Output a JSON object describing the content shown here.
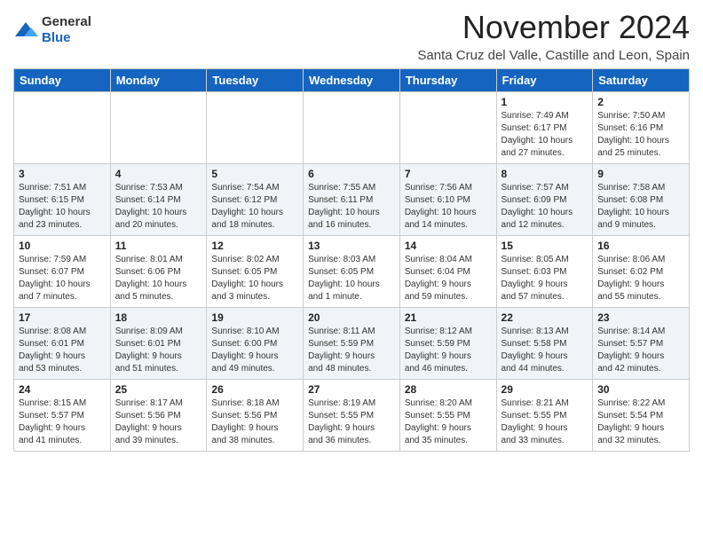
{
  "logo": {
    "general": "General",
    "blue": "Blue"
  },
  "header": {
    "month_year": "November 2024",
    "location": "Santa Cruz del Valle, Castille and Leon, Spain"
  },
  "weekdays": [
    "Sunday",
    "Monday",
    "Tuesday",
    "Wednesday",
    "Thursday",
    "Friday",
    "Saturday"
  ],
  "weeks": [
    [
      {
        "day": "",
        "info": ""
      },
      {
        "day": "",
        "info": ""
      },
      {
        "day": "",
        "info": ""
      },
      {
        "day": "",
        "info": ""
      },
      {
        "day": "",
        "info": ""
      },
      {
        "day": "1",
        "info": "Sunrise: 7:49 AM\nSunset: 6:17 PM\nDaylight: 10 hours\nand 27 minutes."
      },
      {
        "day": "2",
        "info": "Sunrise: 7:50 AM\nSunset: 6:16 PM\nDaylight: 10 hours\nand 25 minutes."
      }
    ],
    [
      {
        "day": "3",
        "info": "Sunrise: 7:51 AM\nSunset: 6:15 PM\nDaylight: 10 hours\nand 23 minutes."
      },
      {
        "day": "4",
        "info": "Sunrise: 7:53 AM\nSunset: 6:14 PM\nDaylight: 10 hours\nand 20 minutes."
      },
      {
        "day": "5",
        "info": "Sunrise: 7:54 AM\nSunset: 6:12 PM\nDaylight: 10 hours\nand 18 minutes."
      },
      {
        "day": "6",
        "info": "Sunrise: 7:55 AM\nSunset: 6:11 PM\nDaylight: 10 hours\nand 16 minutes."
      },
      {
        "day": "7",
        "info": "Sunrise: 7:56 AM\nSunset: 6:10 PM\nDaylight: 10 hours\nand 14 minutes."
      },
      {
        "day": "8",
        "info": "Sunrise: 7:57 AM\nSunset: 6:09 PM\nDaylight: 10 hours\nand 12 minutes."
      },
      {
        "day": "9",
        "info": "Sunrise: 7:58 AM\nSunset: 6:08 PM\nDaylight: 10 hours\nand 9 minutes."
      }
    ],
    [
      {
        "day": "10",
        "info": "Sunrise: 7:59 AM\nSunset: 6:07 PM\nDaylight: 10 hours\nand 7 minutes."
      },
      {
        "day": "11",
        "info": "Sunrise: 8:01 AM\nSunset: 6:06 PM\nDaylight: 10 hours\nand 5 minutes."
      },
      {
        "day": "12",
        "info": "Sunrise: 8:02 AM\nSunset: 6:05 PM\nDaylight: 10 hours\nand 3 minutes."
      },
      {
        "day": "13",
        "info": "Sunrise: 8:03 AM\nSunset: 6:05 PM\nDaylight: 10 hours\nand 1 minute."
      },
      {
        "day": "14",
        "info": "Sunrise: 8:04 AM\nSunset: 6:04 PM\nDaylight: 9 hours\nand 59 minutes."
      },
      {
        "day": "15",
        "info": "Sunrise: 8:05 AM\nSunset: 6:03 PM\nDaylight: 9 hours\nand 57 minutes."
      },
      {
        "day": "16",
        "info": "Sunrise: 8:06 AM\nSunset: 6:02 PM\nDaylight: 9 hours\nand 55 minutes."
      }
    ],
    [
      {
        "day": "17",
        "info": "Sunrise: 8:08 AM\nSunset: 6:01 PM\nDaylight: 9 hours\nand 53 minutes."
      },
      {
        "day": "18",
        "info": "Sunrise: 8:09 AM\nSunset: 6:01 PM\nDaylight: 9 hours\nand 51 minutes."
      },
      {
        "day": "19",
        "info": "Sunrise: 8:10 AM\nSunset: 6:00 PM\nDaylight: 9 hours\nand 49 minutes."
      },
      {
        "day": "20",
        "info": "Sunrise: 8:11 AM\nSunset: 5:59 PM\nDaylight: 9 hours\nand 48 minutes."
      },
      {
        "day": "21",
        "info": "Sunrise: 8:12 AM\nSunset: 5:59 PM\nDaylight: 9 hours\nand 46 minutes."
      },
      {
        "day": "22",
        "info": "Sunrise: 8:13 AM\nSunset: 5:58 PM\nDaylight: 9 hours\nand 44 minutes."
      },
      {
        "day": "23",
        "info": "Sunrise: 8:14 AM\nSunset: 5:57 PM\nDaylight: 9 hours\nand 42 minutes."
      }
    ],
    [
      {
        "day": "24",
        "info": "Sunrise: 8:15 AM\nSunset: 5:57 PM\nDaylight: 9 hours\nand 41 minutes."
      },
      {
        "day": "25",
        "info": "Sunrise: 8:17 AM\nSunset: 5:56 PM\nDaylight: 9 hours\nand 39 minutes."
      },
      {
        "day": "26",
        "info": "Sunrise: 8:18 AM\nSunset: 5:56 PM\nDaylight: 9 hours\nand 38 minutes."
      },
      {
        "day": "27",
        "info": "Sunrise: 8:19 AM\nSunset: 5:55 PM\nDaylight: 9 hours\nand 36 minutes."
      },
      {
        "day": "28",
        "info": "Sunrise: 8:20 AM\nSunset: 5:55 PM\nDaylight: 9 hours\nand 35 minutes."
      },
      {
        "day": "29",
        "info": "Sunrise: 8:21 AM\nSunset: 5:55 PM\nDaylight: 9 hours\nand 33 minutes."
      },
      {
        "day": "30",
        "info": "Sunrise: 8:22 AM\nSunset: 5:54 PM\nDaylight: 9 hours\nand 32 minutes."
      }
    ]
  ]
}
